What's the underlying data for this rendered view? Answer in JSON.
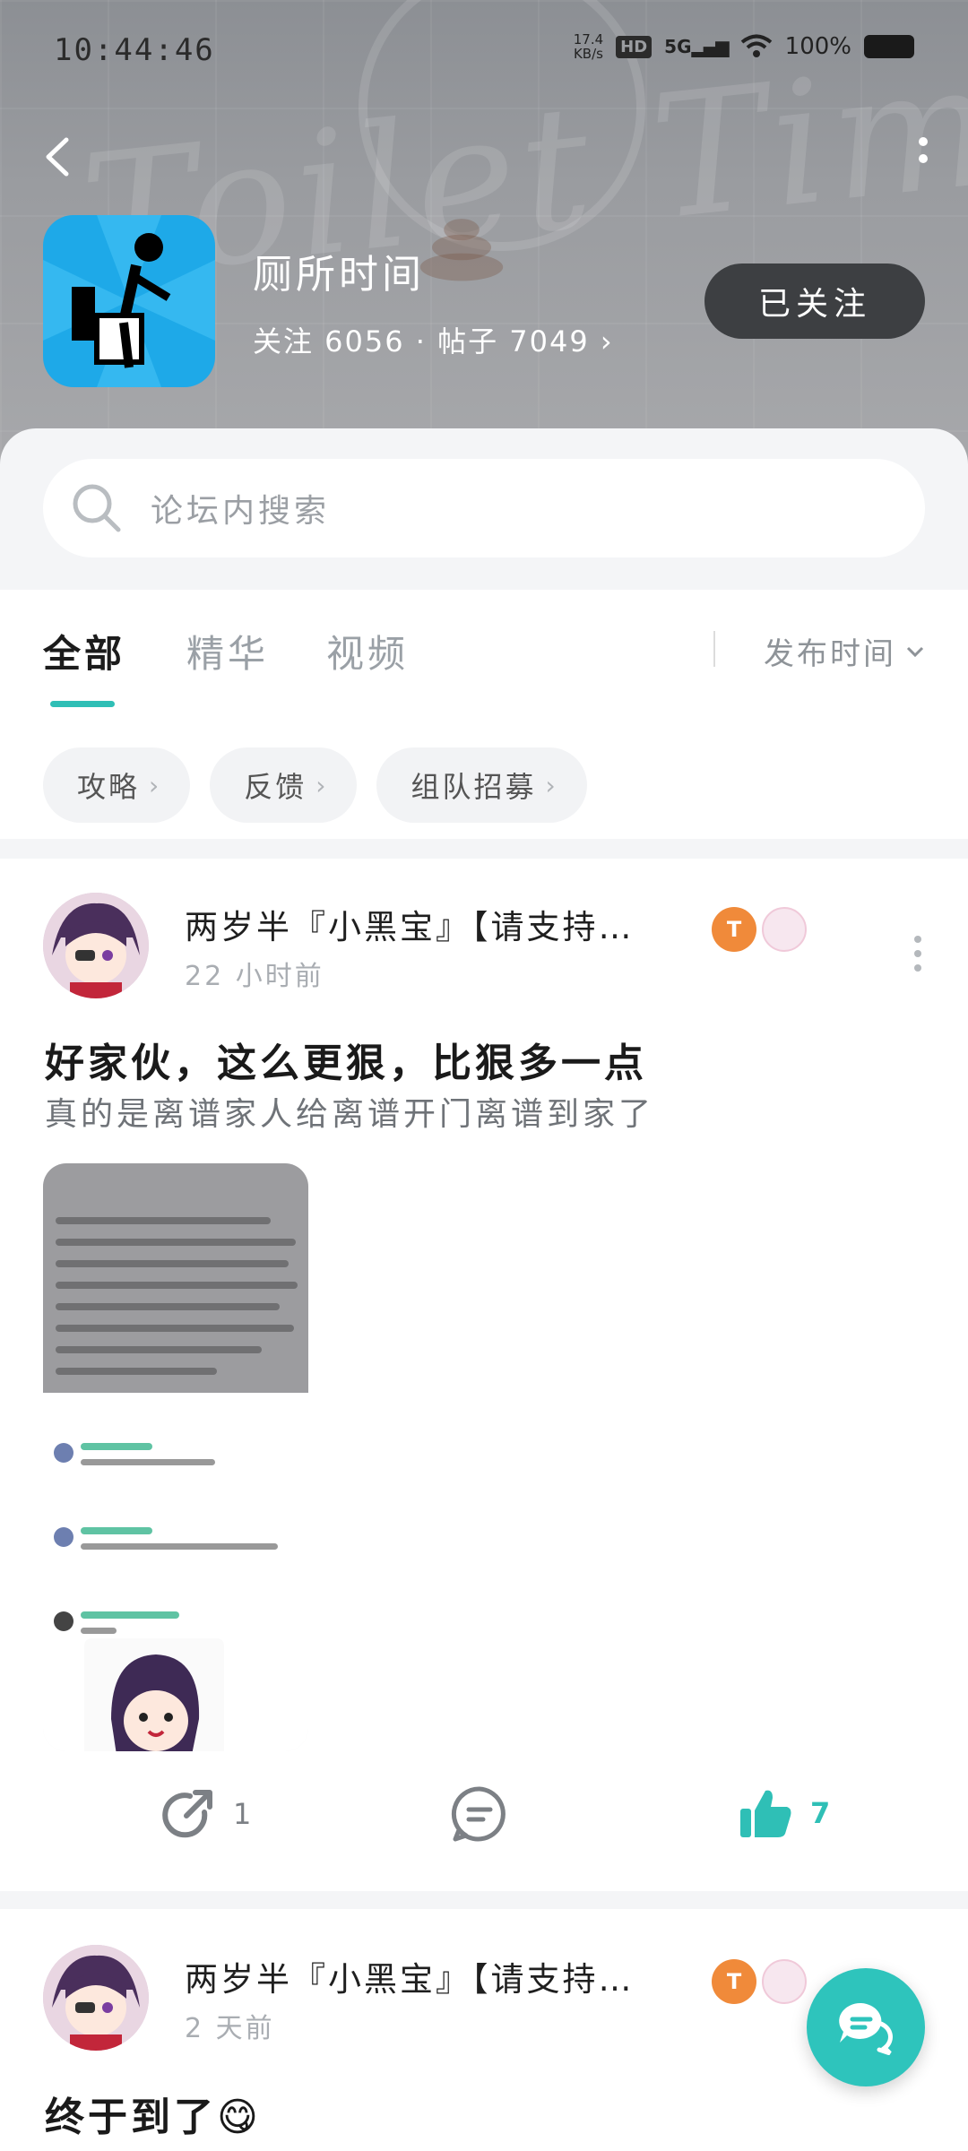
{
  "status_bar": {
    "time": "10:44:46",
    "net_speed_value": "17.4",
    "net_speed_unit": "KB/s",
    "hd": "HD",
    "network": "5G",
    "battery": "100%"
  },
  "forum": {
    "watermark": "Toilet Time!",
    "name": "厕所时间",
    "stats": "关注 6056 · 帖子 7049",
    "follow_label": "已关注"
  },
  "search": {
    "placeholder": "论坛内搜索"
  },
  "tabs": [
    {
      "label": "全部",
      "active": true
    },
    {
      "label": "精华",
      "active": false
    },
    {
      "label": "视频",
      "active": false
    }
  ],
  "sort_label": "发布时间",
  "chips": [
    "攻略",
    "反馈",
    "组队招募"
  ],
  "posts": [
    {
      "author": "两岁半『小黑宝』【请支持…",
      "time": "22 小时前",
      "level_badge": "T",
      "title": "好家伙，这么更狠，比狠多一点",
      "summary": "真的是离谱家人给离谱开门离谱到家了",
      "share_count": "1",
      "like_count": "7"
    },
    {
      "author": "两岁半『小黑宝』【请支持…",
      "time": "2 天前",
      "level_badge": "T",
      "title": "终于到了😋"
    }
  ],
  "colors": {
    "accent": "#2fbfb6",
    "header_bg": "#9a9ca0",
    "follow_bg": "#3d3f42",
    "forum_icon_bg": "#1ea9e8"
  },
  "icons": [
    "back-arrow-icon",
    "more-vertical-icon",
    "search-icon",
    "chevron-down-icon",
    "chevron-right-icon",
    "share-icon",
    "comment-icon",
    "thumbs-up-icon",
    "chat-icon"
  ]
}
